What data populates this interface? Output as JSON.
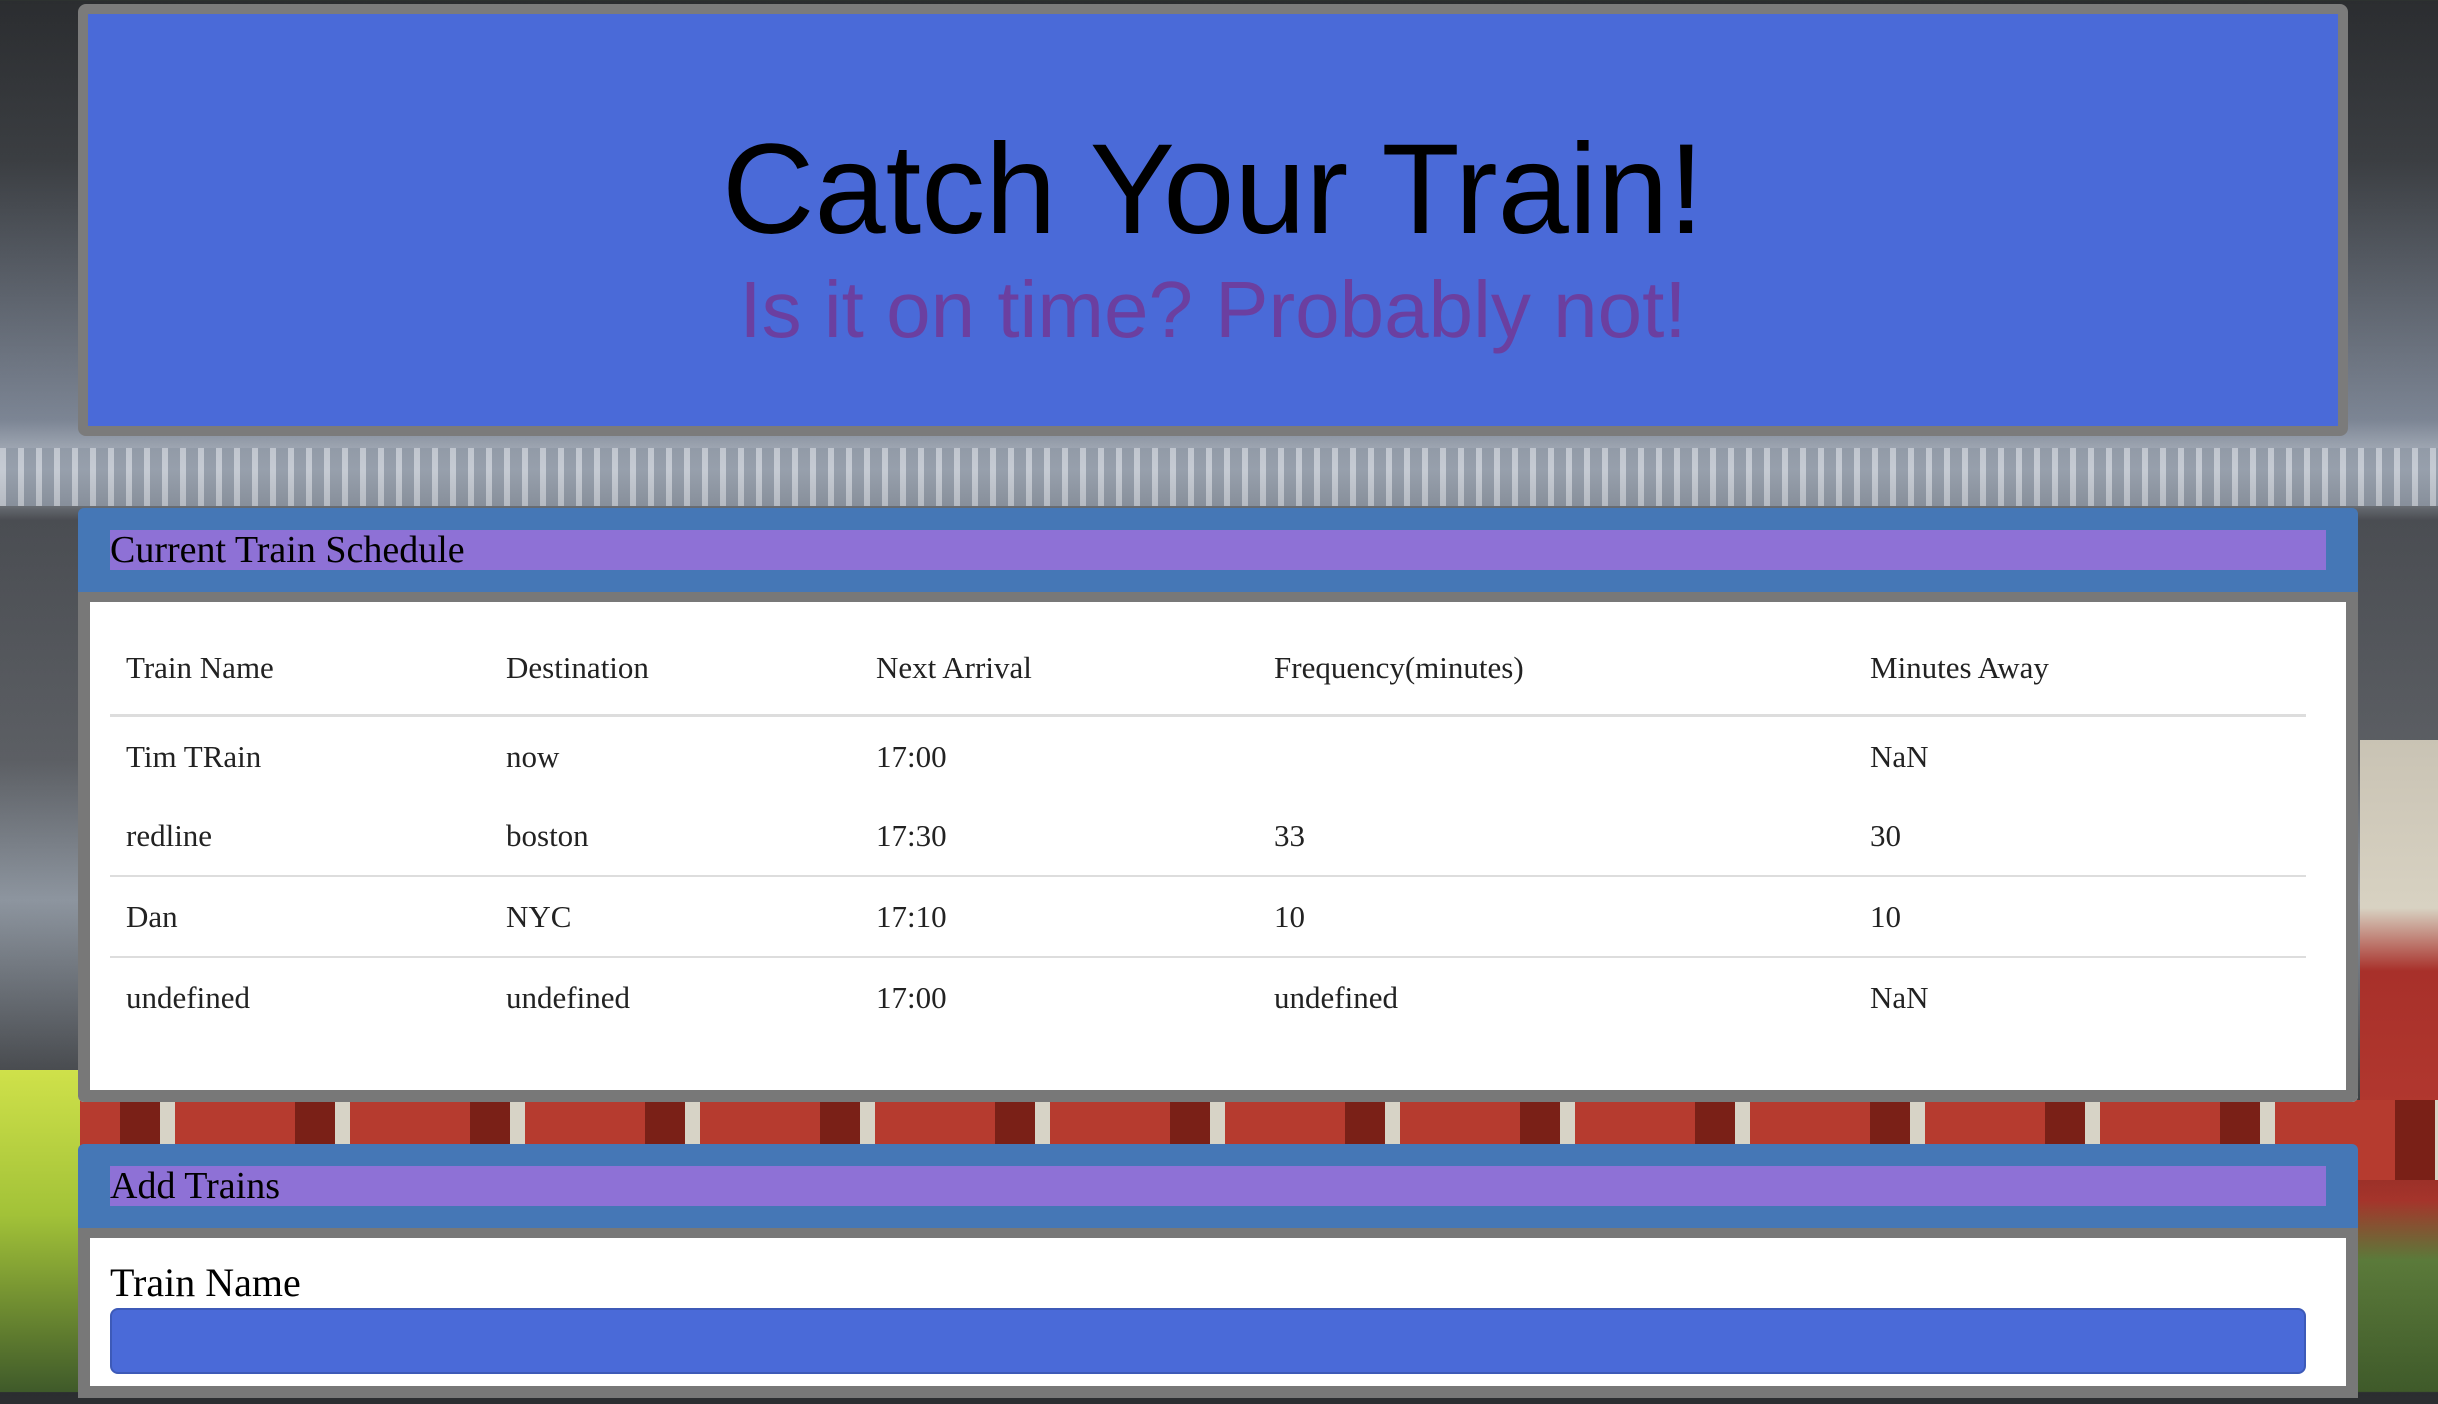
{
  "header": {
    "title": "Catch Your Train!",
    "subtitle": "Is it on time? Probably not!"
  },
  "schedule": {
    "heading": "Current Train Schedule",
    "columns": [
      "Train Name",
      "Destination",
      "Next Arrival",
      "Frequency(minutes)",
      "Minutes Away"
    ],
    "rows": [
      [
        "Tim TRain",
        "now",
        "17:00",
        "",
        "NaN"
      ],
      [
        "redline",
        "boston",
        "17:30",
        "33",
        "30"
      ],
      [
        "Dan",
        "NYC",
        "17:10",
        "10",
        "10"
      ],
      [
        "undefined",
        "undefined",
        "17:00",
        "undefined",
        "NaN"
      ]
    ]
  },
  "add_trains": {
    "heading": "Add Trains",
    "train_name_label": "Train Name",
    "train_name_value": ""
  },
  "colors": {
    "jumbotron_bg": "#4a6ad8",
    "subtitle": "#6b3fa0",
    "panel_heading_bg": "#4577b6",
    "panel_title_bg": "#8e71d6",
    "input_bg": "#4a6ad8"
  }
}
